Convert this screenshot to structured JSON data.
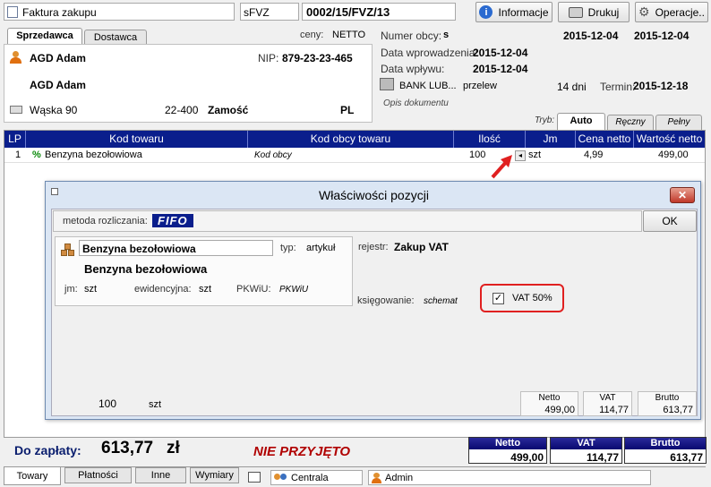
{
  "toolbar": {
    "doc_type": "Faktura zakupu",
    "series": "sFVZ",
    "doc_number": "0002/15/FVZ/13",
    "info_label": "Informacje",
    "print_label": "Drukuj",
    "ops_label": "Operacje.."
  },
  "tabs": {
    "seller": "Sprzedawca",
    "supplier": "Dostawca"
  },
  "prices": {
    "label": "ceny:",
    "value": "NETTO"
  },
  "seller": {
    "name": "AGD Adam",
    "name2": "AGD Adam",
    "nip_label": "NIP:",
    "nip": "879-23-23-465",
    "street": "Wąska 90",
    "postcode": "22-400",
    "city": "Zamość",
    "country": "PL"
  },
  "docinfo": {
    "foreign_label": "Numer obcy:",
    "foreign_value": "s",
    "date1": "2015-12-04",
    "date2": "2015-12-04",
    "entry_label": "Data wprowadzenia:",
    "entry_value": "2015-12-04",
    "receipt_label": "Data wpływu:",
    "receipt_value": "2015-12-04",
    "bank": "BANK LUB...",
    "payment": "przelew",
    "days": "14 dni",
    "term_label": "Termin:",
    "term_value": "2015-12-18",
    "desc_placeholder": "Opis dokumentu"
  },
  "mode": {
    "label": "Tryb:",
    "tabs": [
      "Auto",
      "Ręczny",
      "Pełny"
    ]
  },
  "grid": {
    "headers": [
      "LP",
      "Kod towaru",
      "Kod obcy towaru",
      "Ilość",
      "Jm",
      "Cena netto",
      "Wartość netto"
    ],
    "rows": [
      {
        "lp": "1",
        "mark": "%",
        "name": "Benzyna bezołowiowa",
        "foreign": "Kod obcy",
        "qty": "100",
        "unit": "szt",
        "price": "4,99",
        "value": "499,00"
      }
    ]
  },
  "dialog": {
    "title": "Właściwości pozycji",
    "method_label": "metoda rozliczania:",
    "method_value": "FIFO",
    "ok": "OK",
    "product_name": "Benzyna bezołowiowa",
    "type_label": "typ:",
    "type_value": "artykuł",
    "product_title": "Benzyna bezołowiowa",
    "jm_label": "jm:",
    "jm_value": "szt",
    "evid_label": "ewidencyjna:",
    "evid_value": "szt",
    "pkwiu_label": "PKWiU:",
    "pkwiu_value": "PKWiU",
    "register_label": "rejestr:",
    "register_value": "Zakup VAT",
    "booking_label": "księgowanie:",
    "booking_value": "schemat",
    "vat50_label": "VAT 50%",
    "vat50_checked": true,
    "qty": "100",
    "qty_unit": "szt",
    "netto_label": "Netto",
    "netto_value": "499,00",
    "vat_label": "VAT",
    "vat_value": "114,77",
    "brutto_label": "Brutto",
    "brutto_value": "613,77"
  },
  "footer": {
    "pay_label": "Do zapłaty:",
    "pay_value": "613,77",
    "currency": "zł",
    "status": "NIE PRZYJĘTO",
    "netto_label": "Netto",
    "netto_value": "499,00",
    "vat_label": "VAT",
    "vat_value": "114,77",
    "brutto_label": "Brutto",
    "brutto_value": "613,77"
  },
  "bottomtabs": [
    "Towary",
    "Płatności",
    "Inne",
    "Wymiary"
  ],
  "status": {
    "unit": "Centrala",
    "user": "Admin"
  },
  "colors": {
    "header_blue": "#0a1e8c",
    "highlight": "#e02020",
    "status_red": "#b00000"
  }
}
